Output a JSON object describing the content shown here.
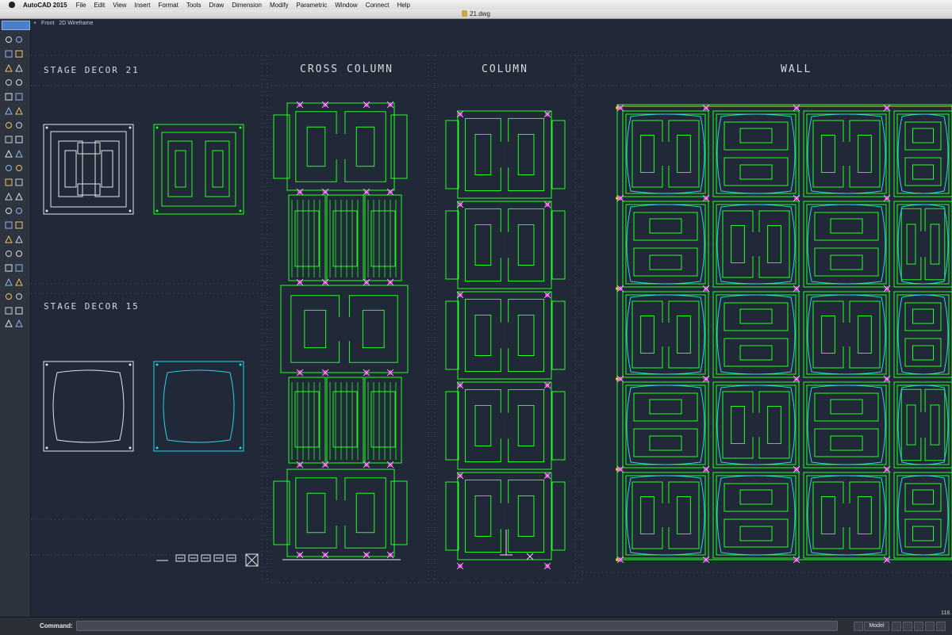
{
  "menubar": {
    "app_name": "AutoCAD 2015",
    "items": [
      "File",
      "Edit",
      "View",
      "Insert",
      "Format",
      "Tools",
      "Draw",
      "Dimension",
      "Modify",
      "Parametric",
      "Window",
      "Connect",
      "Help"
    ]
  },
  "window": {
    "title": "21.dwg"
  },
  "viewport": {
    "view": "Front",
    "visual_style": "2D Wireframe",
    "plus": "+"
  },
  "sections": {
    "stage_decor_21": "STAGE DECOR 21",
    "stage_decor_15": "STAGE DECOR 15",
    "cross_column": "CROSS COLUMN",
    "column": "COLUMN",
    "wall": "WALL"
  },
  "command": {
    "label": "Command:",
    "placeholder": ""
  },
  "status": {
    "model_tab": "Model",
    "coordinate": "118."
  },
  "colors": {
    "background": "#212837",
    "green": "#22ff22",
    "cyan": "#22d8e6",
    "magenta": "#e020e0",
    "white": "#e4e4e4"
  }
}
